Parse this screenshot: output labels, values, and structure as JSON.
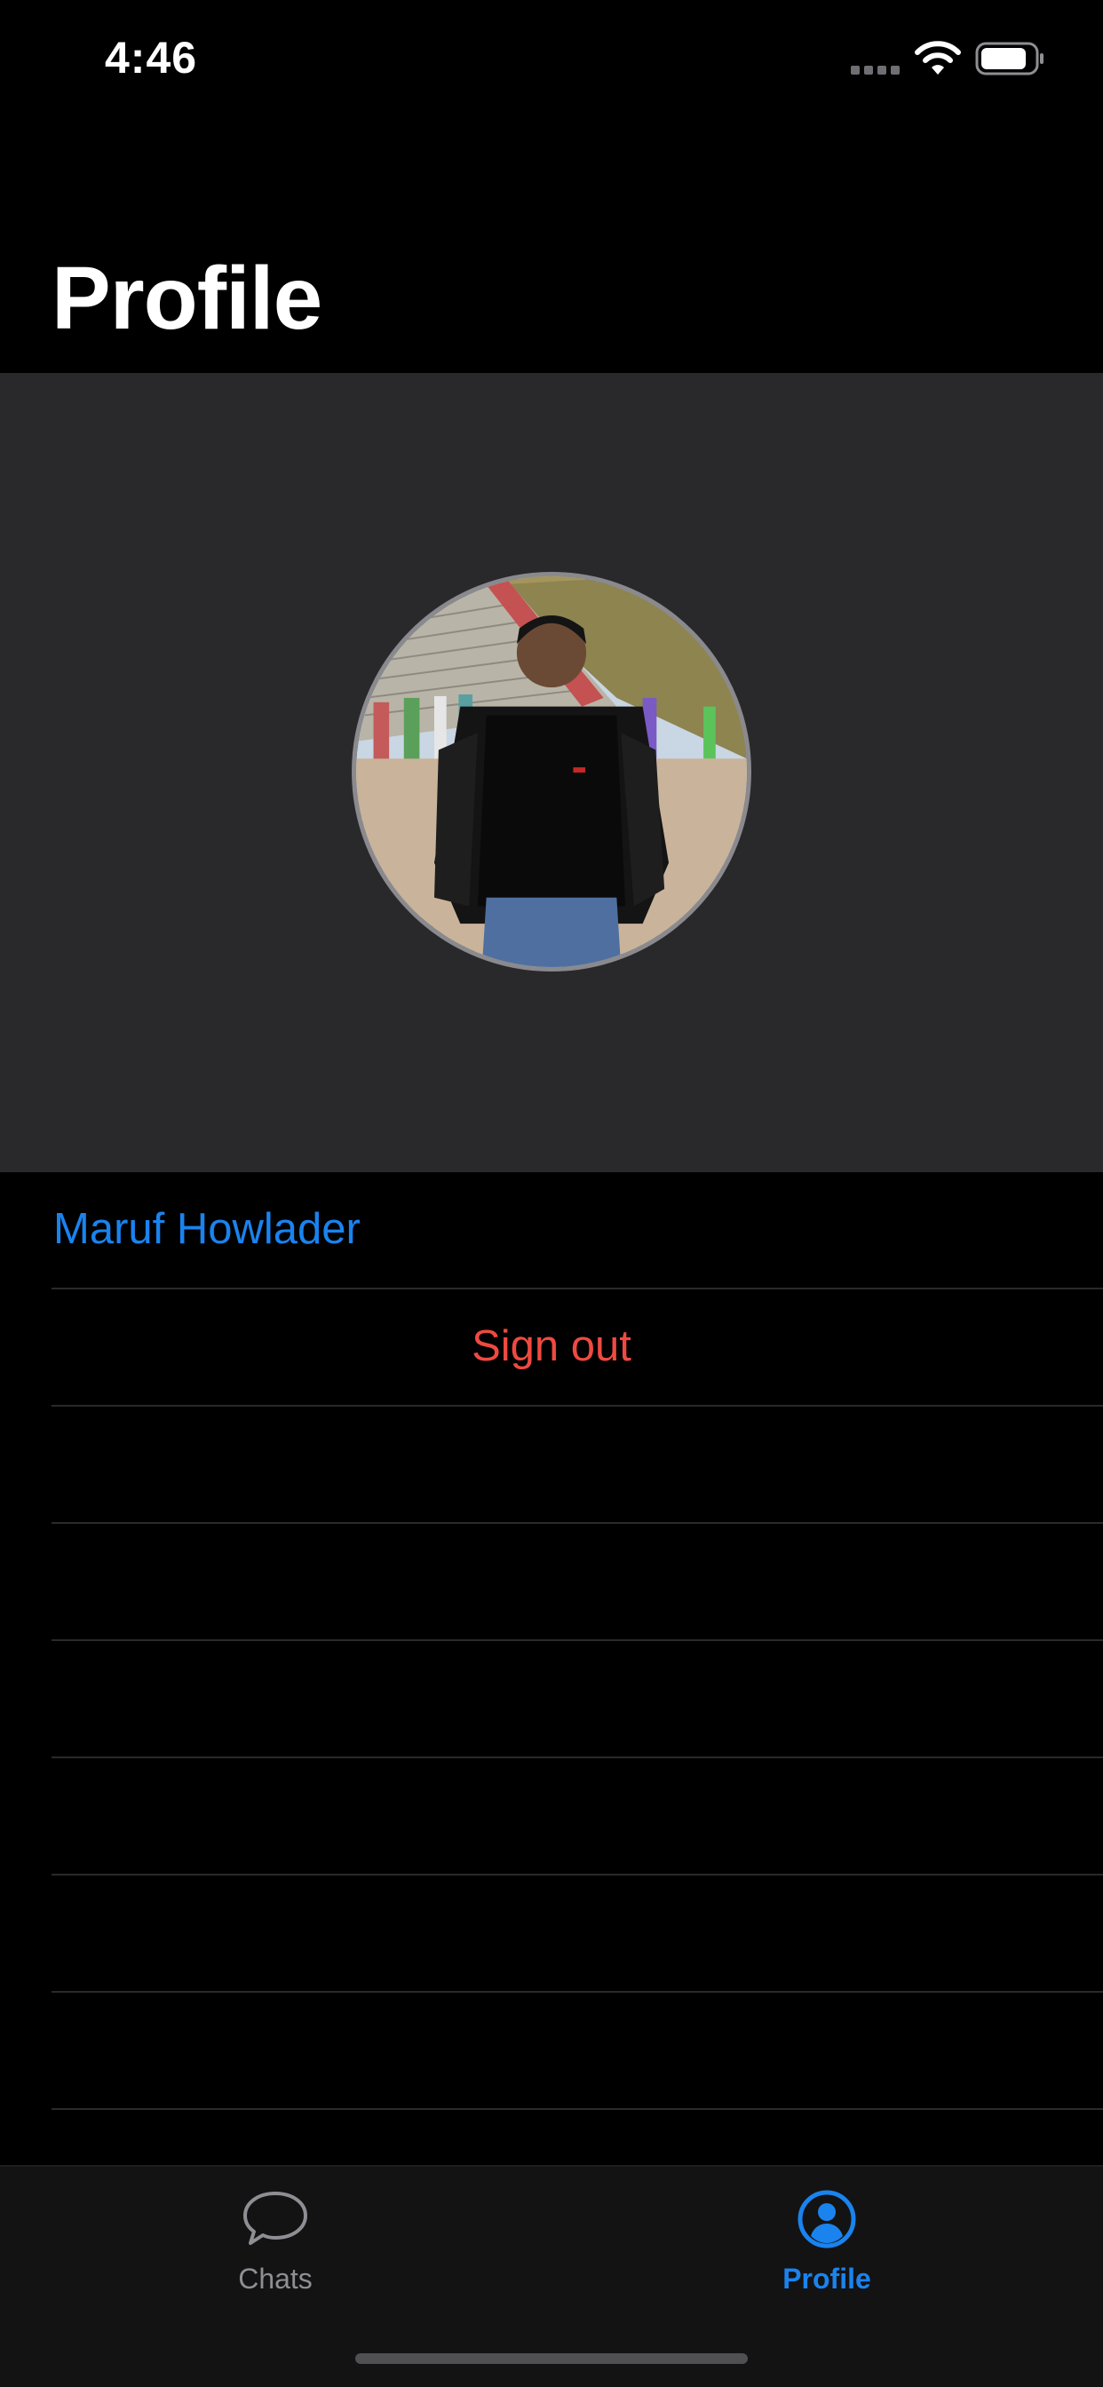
{
  "status_bar": {
    "time": "4:46",
    "icons": [
      "cellular-signal-icon",
      "wifi-icon",
      "battery-icon"
    ]
  },
  "header": {
    "title": "Profile"
  },
  "profile": {
    "avatar_icon": "profile-photo",
    "name": "Maruf Howlader",
    "sign_out_label": "Sign out"
  },
  "tab_bar": {
    "tabs": [
      {
        "label": "Chats",
        "icon": "chat-bubble-icon",
        "selected": false
      },
      {
        "label": "Profile",
        "icon": "person-circle-icon",
        "selected": true
      }
    ]
  },
  "colors": {
    "accent": "#1a83ee",
    "destructive": "#ef4a40",
    "background": "#000000",
    "panel": "#29292c",
    "tab_inactive": "#8e8e93"
  }
}
